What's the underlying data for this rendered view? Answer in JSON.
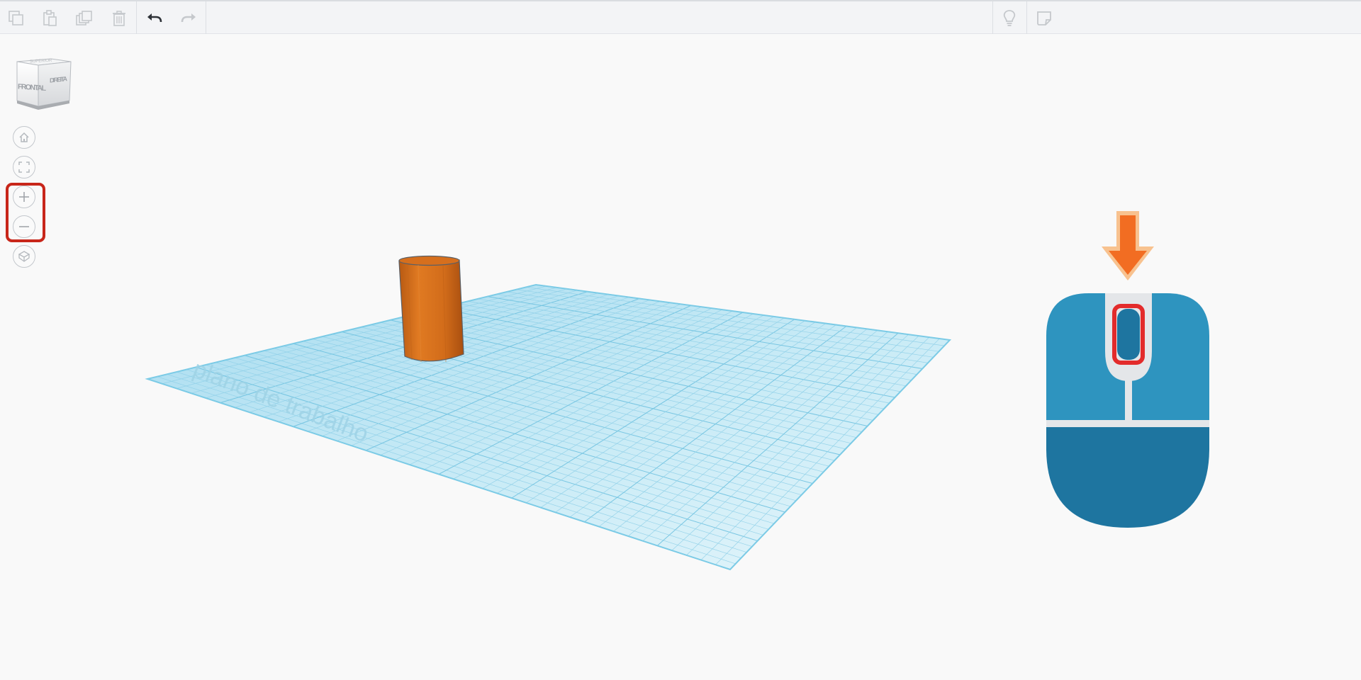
{
  "toolbar": {
    "left_buttons": [
      {
        "name": "copy-button",
        "icon": "copy-icon",
        "enabled": false
      },
      {
        "name": "paste-button",
        "icon": "paste-icon",
        "enabled": false
      },
      {
        "name": "duplicate-button",
        "icon": "duplicate-icon",
        "enabled": false
      },
      {
        "name": "delete-button",
        "icon": "trash-icon",
        "enabled": false
      },
      {
        "name": "undo-button",
        "icon": "undo-icon",
        "enabled": true
      },
      {
        "name": "redo-button",
        "icon": "redo-icon",
        "enabled": false
      }
    ],
    "right_buttons": [
      {
        "name": "show-hints-button",
        "icon": "lightbulb-icon"
      },
      {
        "name": "notes-button",
        "icon": "note-icon"
      }
    ]
  },
  "viewcube": {
    "front_label": "FRONTAL",
    "right_label": "DIREITA",
    "top_label": "SUPERIOR"
  },
  "navigation": [
    {
      "name": "home-view-button",
      "icon": "home-icon"
    },
    {
      "name": "fit-all-button",
      "icon": "fit-view-icon"
    },
    {
      "name": "zoom-in-button",
      "icon": "plus-icon"
    },
    {
      "name": "zoom-out-button",
      "icon": "minus-icon"
    },
    {
      "name": "perspective-toggle-button",
      "icon": "perspective-cube-icon"
    }
  ],
  "workplane": {
    "label": "plano de trabalho",
    "color": "#bfe6f4",
    "grid_color": "#7ccbe6"
  },
  "shape": {
    "type": "cylinder",
    "color": "#d96e1b"
  },
  "mouse_illustration": {
    "body_top_color": "#2e94bf",
    "body_bottom_color": "#1e75a0",
    "arrow_color": "#f26d22",
    "highlight_color": "#e32b2b",
    "icon": "mouse-scroll-wheel-icon"
  },
  "colors": {
    "highlight_red": "#c8261a",
    "toolbar_bg": "#f3f4f6",
    "canvas_bg": "#f9f9f9"
  }
}
